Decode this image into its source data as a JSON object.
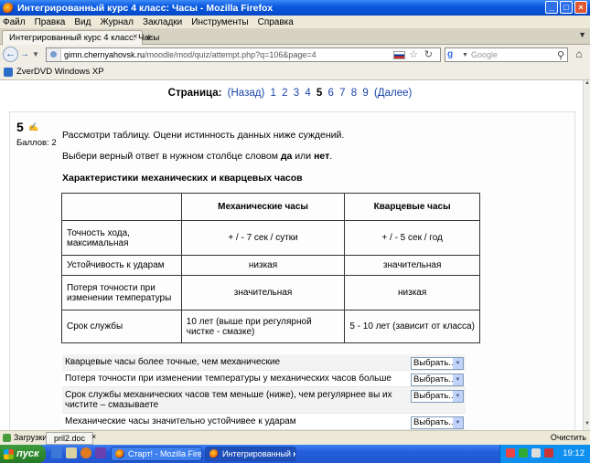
{
  "window": {
    "title": "Интегрированный курс 4 класс: Часы - Mozilla Firefox",
    "buttons": {
      "minimize": "_",
      "maximize": "□",
      "close": "×"
    }
  },
  "menu": [
    "Файл",
    "Правка",
    "Вид",
    "Журнал",
    "Закладки",
    "Инструменты",
    "Справка"
  ],
  "tabs": [
    {
      "label": "Интегрированный курс 4 класс: Часы",
      "close": "×"
    }
  ],
  "new_tab_symbol": "+",
  "nav": {
    "back": "←",
    "forward": "→",
    "history": "▼",
    "url_domain": "gimn.chernyahovsk.ru",
    "url_path": "/moodle/mod/quiz/attempt.php?q=106&page=4",
    "star": "☆",
    "reload": "↻",
    "search_engine": "g",
    "search_engine_arrow": "▼",
    "search_placeholder": "Google",
    "search_icon": "⚲",
    "home": "⌂"
  },
  "bookmarks": [
    {
      "label": "ZverDVD Windows XP"
    }
  ],
  "pager": {
    "label": "Страница:",
    "prev": "(Назад)",
    "pages": [
      "1",
      "2",
      "3",
      "4"
    ],
    "current": "5",
    "pages_after": [
      "6",
      "7",
      "8",
      "9"
    ],
    "next": "(Далее)"
  },
  "question": {
    "number": "5",
    "edit_icon": "✍",
    "score": "Баллов: 2",
    "text1": "Рассмотри таблицу. Оцени истинность данных ниже суждений.",
    "text2_prefix": "Выбери верный ответ в нужном столбце словом ",
    "text2_yes": "да",
    "text2_or": " или ",
    "text2_no": "нет",
    "text2_suffix": ".",
    "table_title": "Характеристики механических и кварцевых часов",
    "table": {
      "headers": [
        "",
        "Механические часы",
        "Кварцевые часы"
      ],
      "rows": [
        [
          "Точность хода, максимальная",
          "+ / - 7 сек / сутки",
          "+ / - 5 сек / год"
        ],
        [
          "Устойчивость к ударам",
          "низкая",
          "значительная"
        ],
        [
          "Потеря точности при изменении температуры",
          "значительная",
          "низкая"
        ],
        [
          "Срок службы",
          "10 лет (выше при регулярной чистке - смазке)",
          "5 - 10 лет (зависит от класса)"
        ]
      ]
    },
    "select_label": "Выбрать...",
    "select_arrow": "▼",
    "statements": [
      "Кварцевые часы более точные, чем механические",
      "Потеря точности при изменении температуры у механических часов больше",
      "Срок службы механических часов тем меньше (ниже), чем регулярнее вы их чистите – смазываете",
      "Механические часы значительно устойчивее к ударам"
    ]
  },
  "scroll": {
    "up": "▲",
    "down": "▼"
  },
  "statusbar": {
    "downloads": "Загрузки",
    "file": "pril2.doc",
    "close": "×",
    "clear": "Очистить"
  },
  "taskbar": {
    "start": "пуск",
    "tasks": [
      "Старт! - Mozilla Firefox",
      "Интегрированный к..."
    ],
    "clock": "19:12"
  }
}
